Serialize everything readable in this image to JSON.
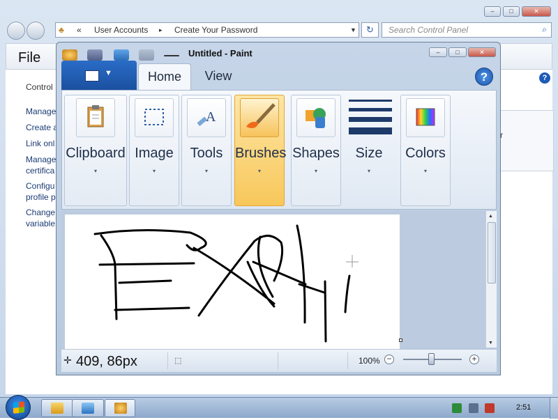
{
  "control_panel": {
    "breadcrumb_sep": "«",
    "breadcrumb_1": "User Accounts",
    "breadcrumb_arrow": "▸",
    "breadcrumb_2": "Create Your Password",
    "search_placeholder": "Search Control Panel",
    "menu_file": "File",
    "left_links": [
      "Control",
      "Manage",
      "Create a",
      "Link onl",
      "Manage\ncertifica",
      "Configu\nprofile p",
      "Change\nvariable"
    ],
    "right_box_text": "r",
    "help": "?"
  },
  "paint": {
    "title": "Untitled - Paint",
    "tabs": [
      "Home",
      "View"
    ],
    "help": "?",
    "groups": [
      "Clipboard",
      "Image",
      "Tools",
      "Brushes",
      "Shapes",
      "Size",
      "Colors"
    ],
    "active_group": "Brushes",
    "dropdown_arrow": "▾",
    "cursor_position": "409, 86px",
    "zoom_level": "100%",
    "zoom_minus": "−",
    "zoom_plus": "+"
  },
  "taskbar": {
    "clock": "2:51"
  },
  "colors": {
    "accent": "#1a4f9e",
    "active_group": "#f8c75a",
    "stroke": "#000000"
  }
}
